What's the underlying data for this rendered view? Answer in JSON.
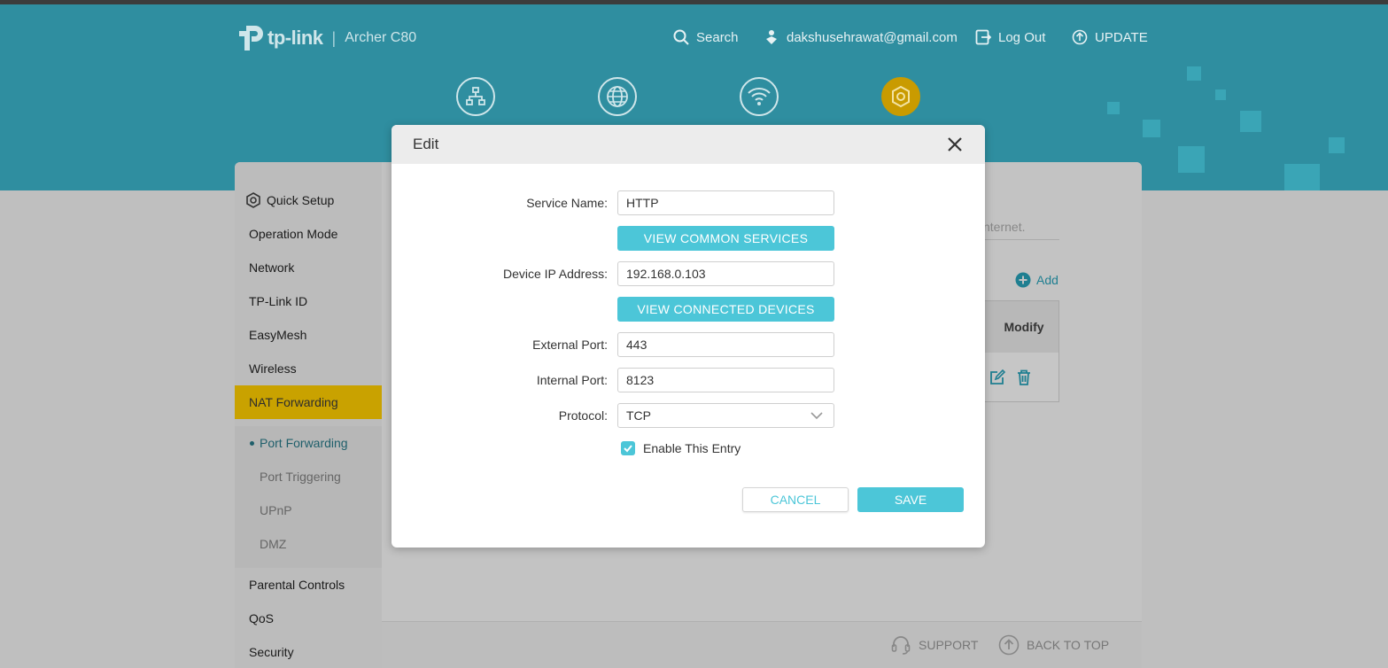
{
  "header": {
    "brand": "tp-link",
    "separator": "|",
    "model": "Archer C80",
    "search_label": "Search",
    "user_email": "dakshusehrawat@gmail.com",
    "logout_label": "Log Out",
    "update_label": "UPDATE",
    "mode_icons": [
      "network-map-icon",
      "internet-icon",
      "wireless-icon",
      "advanced-icon"
    ],
    "colors": {
      "header_bg": "#2f8ea0",
      "active_mode": "#c99b00",
      "accent": "#4cc6d8"
    }
  },
  "sidebar": {
    "items": [
      {
        "label": "Quick Setup"
      },
      {
        "label": "Operation Mode"
      },
      {
        "label": "Network"
      },
      {
        "label": "TP-Link ID"
      },
      {
        "label": "EasyMesh"
      },
      {
        "label": "Wireless"
      },
      {
        "label": "NAT Forwarding"
      },
      {
        "label": "Parental Controls"
      },
      {
        "label": "QoS"
      },
      {
        "label": "Security"
      }
    ],
    "sub_items": [
      {
        "label": "Port Forwarding"
      },
      {
        "label": "Port Triggering"
      },
      {
        "label": "UPnP"
      },
      {
        "label": "DMZ"
      }
    ]
  },
  "background": {
    "internet_text": "nternet.",
    "add_label": "Add",
    "table_header": "Modify"
  },
  "footer": {
    "support_label": "SUPPORT",
    "back_to_top_label": "BACK TO TOP"
  },
  "modal": {
    "title": "Edit",
    "service_name_label": "Service Name:",
    "service_name_value": "HTTP",
    "view_services_label": "VIEW COMMON SERVICES",
    "device_ip_label": "Device IP Address:",
    "device_ip_value": "192.168.0.103",
    "view_devices_label": "VIEW CONNECTED DEVICES",
    "external_port_label": "External Port:",
    "external_port_value": "443",
    "internal_port_label": "Internal Port:",
    "internal_port_value": "8123",
    "protocol_label": "Protocol:",
    "protocol_value": "TCP",
    "enable_label": "Enable This Entry",
    "enable_checked": true,
    "cancel_label": "CANCEL",
    "save_label": "SAVE"
  }
}
